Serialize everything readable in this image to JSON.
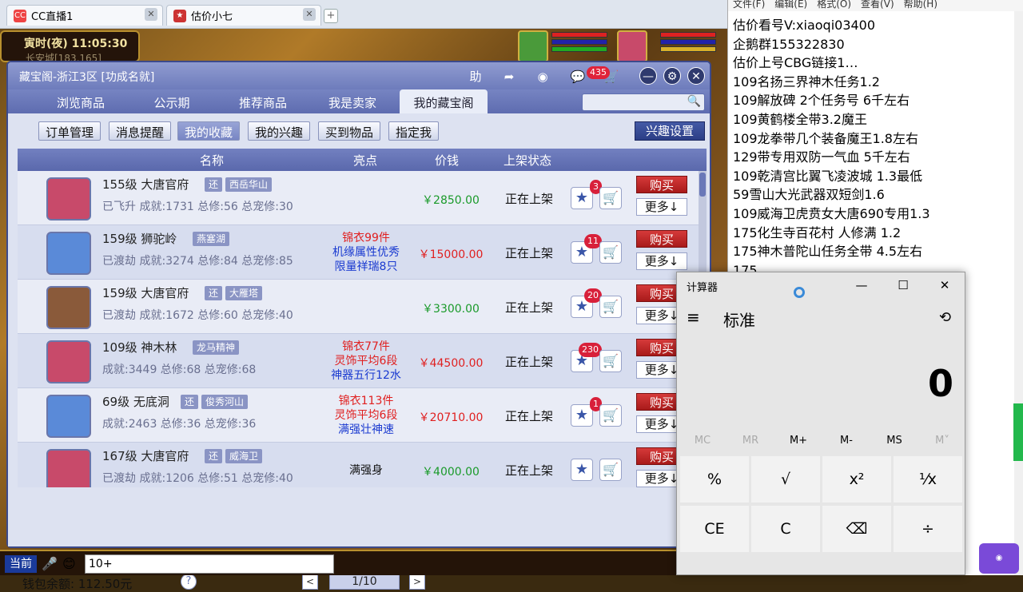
{
  "browser": {
    "tabs": [
      {
        "label": "CC直播1"
      },
      {
        "label": "估价小七"
      }
    ],
    "new_tab": "+"
  },
  "hud": {
    "clock": "寅时(夜)  11:05:30",
    "location": "长安城[183,165]"
  },
  "window": {
    "title": "藏宝阁-浙江3区 [功成名就]",
    "help_label": "助",
    "cart_count": "435"
  },
  "nav_tabs": [
    {
      "label": "浏览商品"
    },
    {
      "label": "公示期"
    },
    {
      "label": "推荐商品"
    },
    {
      "label": "我是卖家"
    },
    {
      "label": "我的藏宝阁"
    }
  ],
  "filters": [
    {
      "label": "订单管理"
    },
    {
      "label": "消息提醒"
    },
    {
      "label": "我的收藏"
    },
    {
      "label": "我的兴趣"
    },
    {
      "label": "买到物品"
    },
    {
      "label": "指定我"
    }
  ],
  "interest_settings": "兴趣设置",
  "columns": {
    "name": "名称",
    "highlight": "亮点",
    "price": "价钱",
    "status": "上架状态"
  },
  "rows": [
    {
      "level": "155级",
      "school": "大唐官府",
      "flag": "还",
      "server": "西岳华山",
      "sub": "已飞升 成就:1731 总修:56 总宠修:30",
      "hl": [],
      "price": "￥2850.00",
      "price_color": "green",
      "status": "正在上架",
      "fav": "3",
      "buy": "购买",
      "more": "更多↓"
    },
    {
      "level": "159级",
      "school": "狮驼岭",
      "flag": "",
      "server": "燕塞湖",
      "sub": "已渡劫 成就:3274 总修:84 总宠修:85",
      "hl": [
        {
          "t": "锦衣99件",
          "c": "#e02020"
        },
        {
          "t": "机缘属性优秀",
          "c": "#1a3ad0"
        },
        {
          "t": "限量祥瑞8只",
          "c": "#1a3ad0"
        }
      ],
      "price": "￥15000.00",
      "price_color": "red",
      "status": "正在上架",
      "fav": "11",
      "buy": "购买",
      "more": "更多↓"
    },
    {
      "level": "159级",
      "school": "大唐官府",
      "flag": "还",
      "server": "大雁塔",
      "sub": "已渡劫 成就:1672 总修:60 总宠修:40",
      "hl": [],
      "price": "￥3300.00",
      "price_color": "green",
      "status": "正在上架",
      "fav": "20",
      "buy": "购买",
      "more": "更多↓"
    },
    {
      "level": "109级",
      "school": "神木林",
      "flag": "",
      "server": "龙马精神",
      "sub": "成就:3449 总修:68 总宠修:68",
      "hl": [
        {
          "t": "锦衣77件",
          "c": "#e02020"
        },
        {
          "t": "灵饰平均6段",
          "c": "#e02020"
        },
        {
          "t": "神器五行12水",
          "c": "#1a3ad0"
        }
      ],
      "price": "￥44500.00",
      "price_color": "red",
      "status": "正在上架",
      "fav": "230",
      "buy": "购买",
      "more": "更多↓"
    },
    {
      "level": "69级",
      "school": "无底洞",
      "flag": "还",
      "server": "俊秀河山",
      "sub": "成就:2463 总修:36 总宠修:36",
      "hl": [
        {
          "t": "锦衣113件",
          "c": "#e02020"
        },
        {
          "t": "灵饰平均6段",
          "c": "#e02020"
        },
        {
          "t": "满强壮神速",
          "c": "#1a3ad0"
        }
      ],
      "price": "￥20710.00",
      "price_color": "red",
      "status": "正在上架",
      "fav": "1",
      "buy": "购买",
      "more": "更多↓"
    },
    {
      "level": "167级",
      "school": "大唐官府",
      "flag": "还",
      "server": "威海卫",
      "sub": "已渡劫 成就:1206 总修:51 总宠修:40",
      "hl": [
        {
          "t": "满强身",
          "c": "#111"
        }
      ],
      "price": "￥4000.00",
      "price_color": "green",
      "status": "正在上架",
      "fav": "",
      "buy": "购买",
      "more": "更多↓"
    }
  ],
  "footer": {
    "wallet": "钱包余额: 112.50元",
    "help": "?",
    "page": "1/10",
    "prev": "<",
    "next": ">"
  },
  "gamebar": {
    "channel": "当前",
    "input": "10+"
  },
  "notepad": {
    "menu": [
      "文件(F)",
      "编辑(E)",
      "格式(O)",
      "查看(V)",
      "帮助(H)"
    ],
    "lines": [
      "估价看号V:xiaoqi03400",
      "企鹅群155322830",
      "估价上号CBG链接1…",
      "109名扬三界神木任务1.2",
      "109解放碑 2个任务号 6千左右",
      "109黄鹤楼全带3.2魔王",
      "109龙拳带几个装备魔王1.8左右",
      "129带专用双防一气血 5千左右",
      "109乾清宫比翼飞凌波城 1.3最低",
      "59雪山大光武器双短剑1.6",
      "109威海卫虎贲女大唐690专用1.3",
      "175化生寺百花村 人修满 1.2",
      "175神木普陀山任务全带 4.5左右",
      "175…"
    ]
  },
  "calculator": {
    "title": "计算器",
    "mode": "标准",
    "display": "0",
    "menu_icon": "≡",
    "history_icon": "⟲",
    "memory": [
      "MC",
      "MR",
      "M+",
      "M-",
      "MS",
      "M˅"
    ],
    "keys": [
      [
        "%",
        "√",
        "x²",
        "¹⁄x"
      ],
      [
        "CE",
        "C",
        "⌫",
        "÷"
      ]
    ]
  },
  "colors": {
    "window_title": "#6e7cbc",
    "buy": "#c02626",
    "price_red": "#e02020",
    "price_green": "#1a9a2a"
  }
}
